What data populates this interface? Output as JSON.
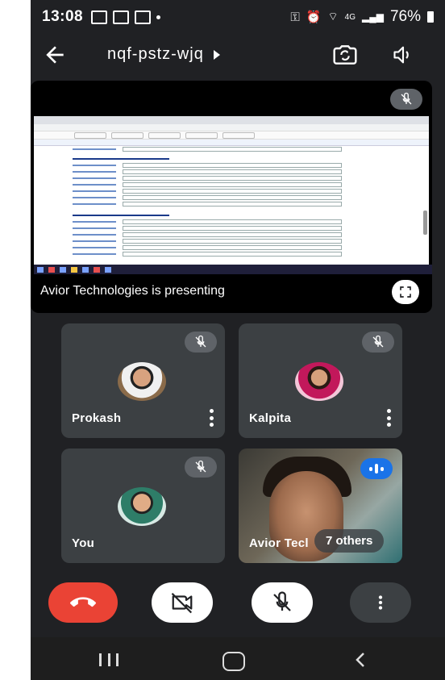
{
  "status_bar": {
    "time": "13:08",
    "battery": "76%",
    "network_label": "4G"
  },
  "appbar": {
    "meeting_code": "nqf-pstz-wjq"
  },
  "presentation": {
    "presenting_text": "Avior Technologies is presenting"
  },
  "participants": [
    {
      "name": "Prokash",
      "muted": true
    },
    {
      "name": "Kalpita",
      "muted": true
    },
    {
      "name": "You",
      "muted": true
    },
    {
      "name": "Avior Tecl",
      "muted": false,
      "speaking": true
    }
  ],
  "others_pill": "7 others",
  "colors": {
    "background": "#202124",
    "tile": "#3c4043",
    "end_call": "#ea4335",
    "speaking_badge": "#1a73e8"
  },
  "icons": {
    "back": "arrow-left",
    "switch_camera": "switch-camera",
    "speaker": "volume",
    "mic_off": "mic-off",
    "camera_off": "videocam-off",
    "end_call": "call-end",
    "fullscreen": "fullscreen",
    "more": "more-vertical"
  }
}
